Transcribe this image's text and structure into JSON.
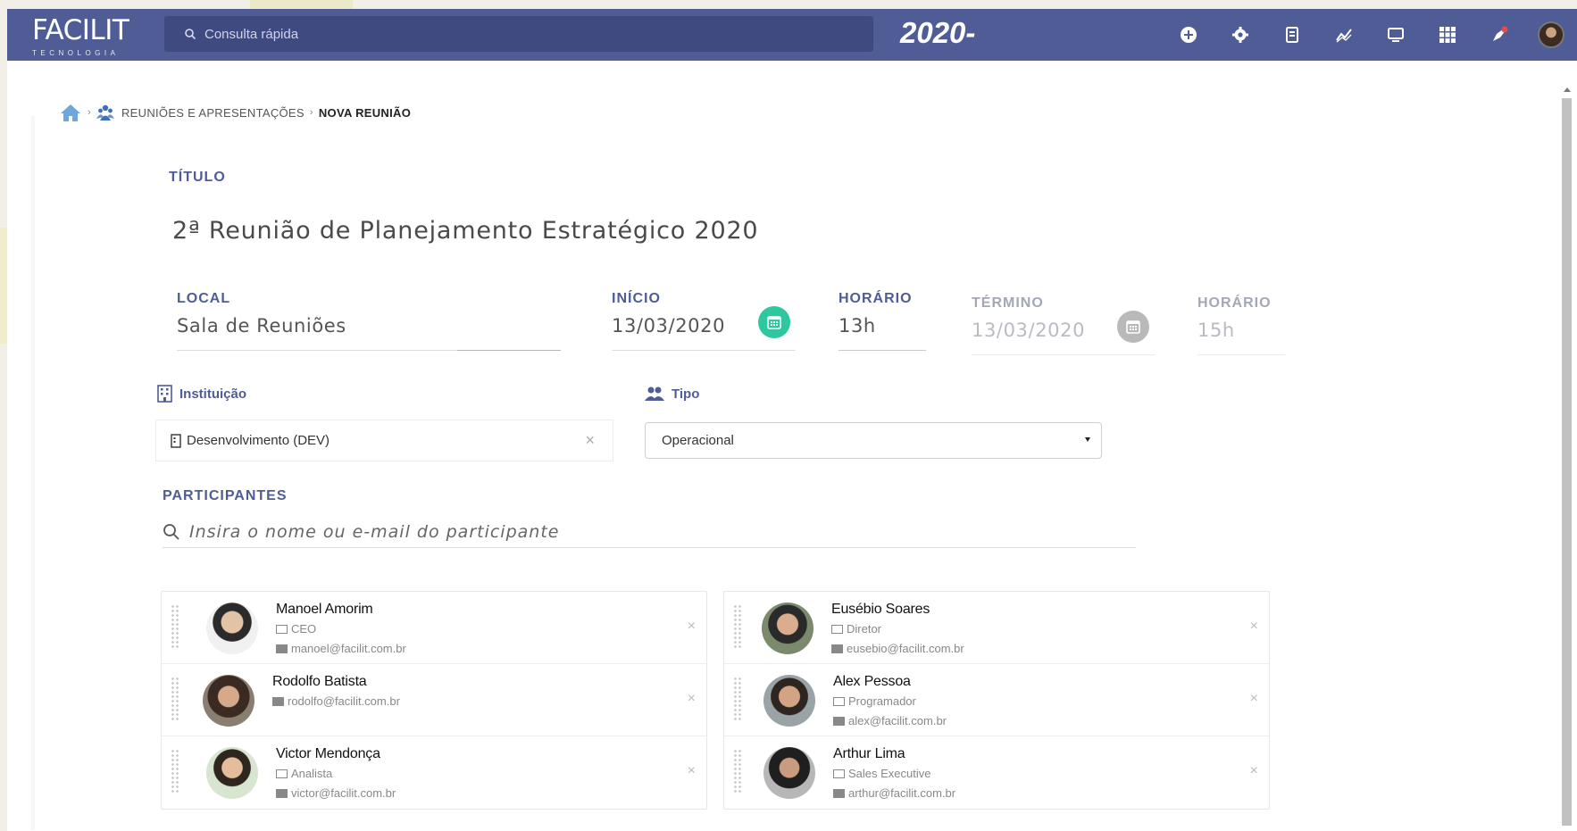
{
  "app": {
    "logo_name": "FACILIT",
    "logo_sub": "TECNOLOGIA",
    "search_placeholder": "Consulta rápida",
    "year": "2020-",
    "top_icons": [
      "add-circle-icon",
      "settings-icon",
      "document-icon",
      "chart-line-icon",
      "monitor-icon",
      "apps-grid-icon",
      "rocket-notification-icon",
      "user-avatar"
    ]
  },
  "breadcrumb": {
    "section": "REUNIÕES E APRESENTAÇÕES",
    "current": "NOVA REUNIÃO"
  },
  "form": {
    "title_label": "TÍTULO",
    "title_value": "2ª Reunião de Planejamento Estratégico 2020",
    "local_label": "LOCAL",
    "local_value": "Sala de Reuniões",
    "inicio_label": "INÍCIO",
    "inicio_value": "13/03/2020",
    "horario_label": "HORÁRIO",
    "horario_value": "13h",
    "termino_label": "TÉRMINO",
    "termino_value": "13/03/2020",
    "horario2_label": "HORÁRIO",
    "horario2_value": "15h",
    "instituicao_label": "Instituição",
    "instituicao_value": "Desenvolvimento (DEV)",
    "tipo_label": "Tipo",
    "tipo_value": "Operacional",
    "participantes_label": "PARTICIPANTES",
    "participantes_placeholder": "Insira o nome ou e-mail do participante"
  },
  "participants_left": [
    {
      "name": "Manoel Amorim",
      "role": "CEO",
      "email": "manoel@facilit.com.br"
    },
    {
      "name": "Rodolfo Batista",
      "role": "",
      "email": "rodolfo@facilit.com.br"
    },
    {
      "name": "Victor Mendonça",
      "role": "Analista",
      "email": "victor@facilit.com.br"
    }
  ],
  "participants_right": [
    {
      "name": "Eusébio Soares",
      "role": "Diretor",
      "email": "eusebio@facilit.com.br"
    },
    {
      "name": "Alex Pessoa",
      "role": "Programador",
      "email": "alex@facilit.com.br"
    },
    {
      "name": "Arthur Lima",
      "role": "Sales Executive",
      "email": "arthur@facilit.com.br"
    }
  ],
  "colors": {
    "topbar": "#4f5c96",
    "accent_green": "#2dc7a0",
    "label_blue": "#4f5c96"
  }
}
